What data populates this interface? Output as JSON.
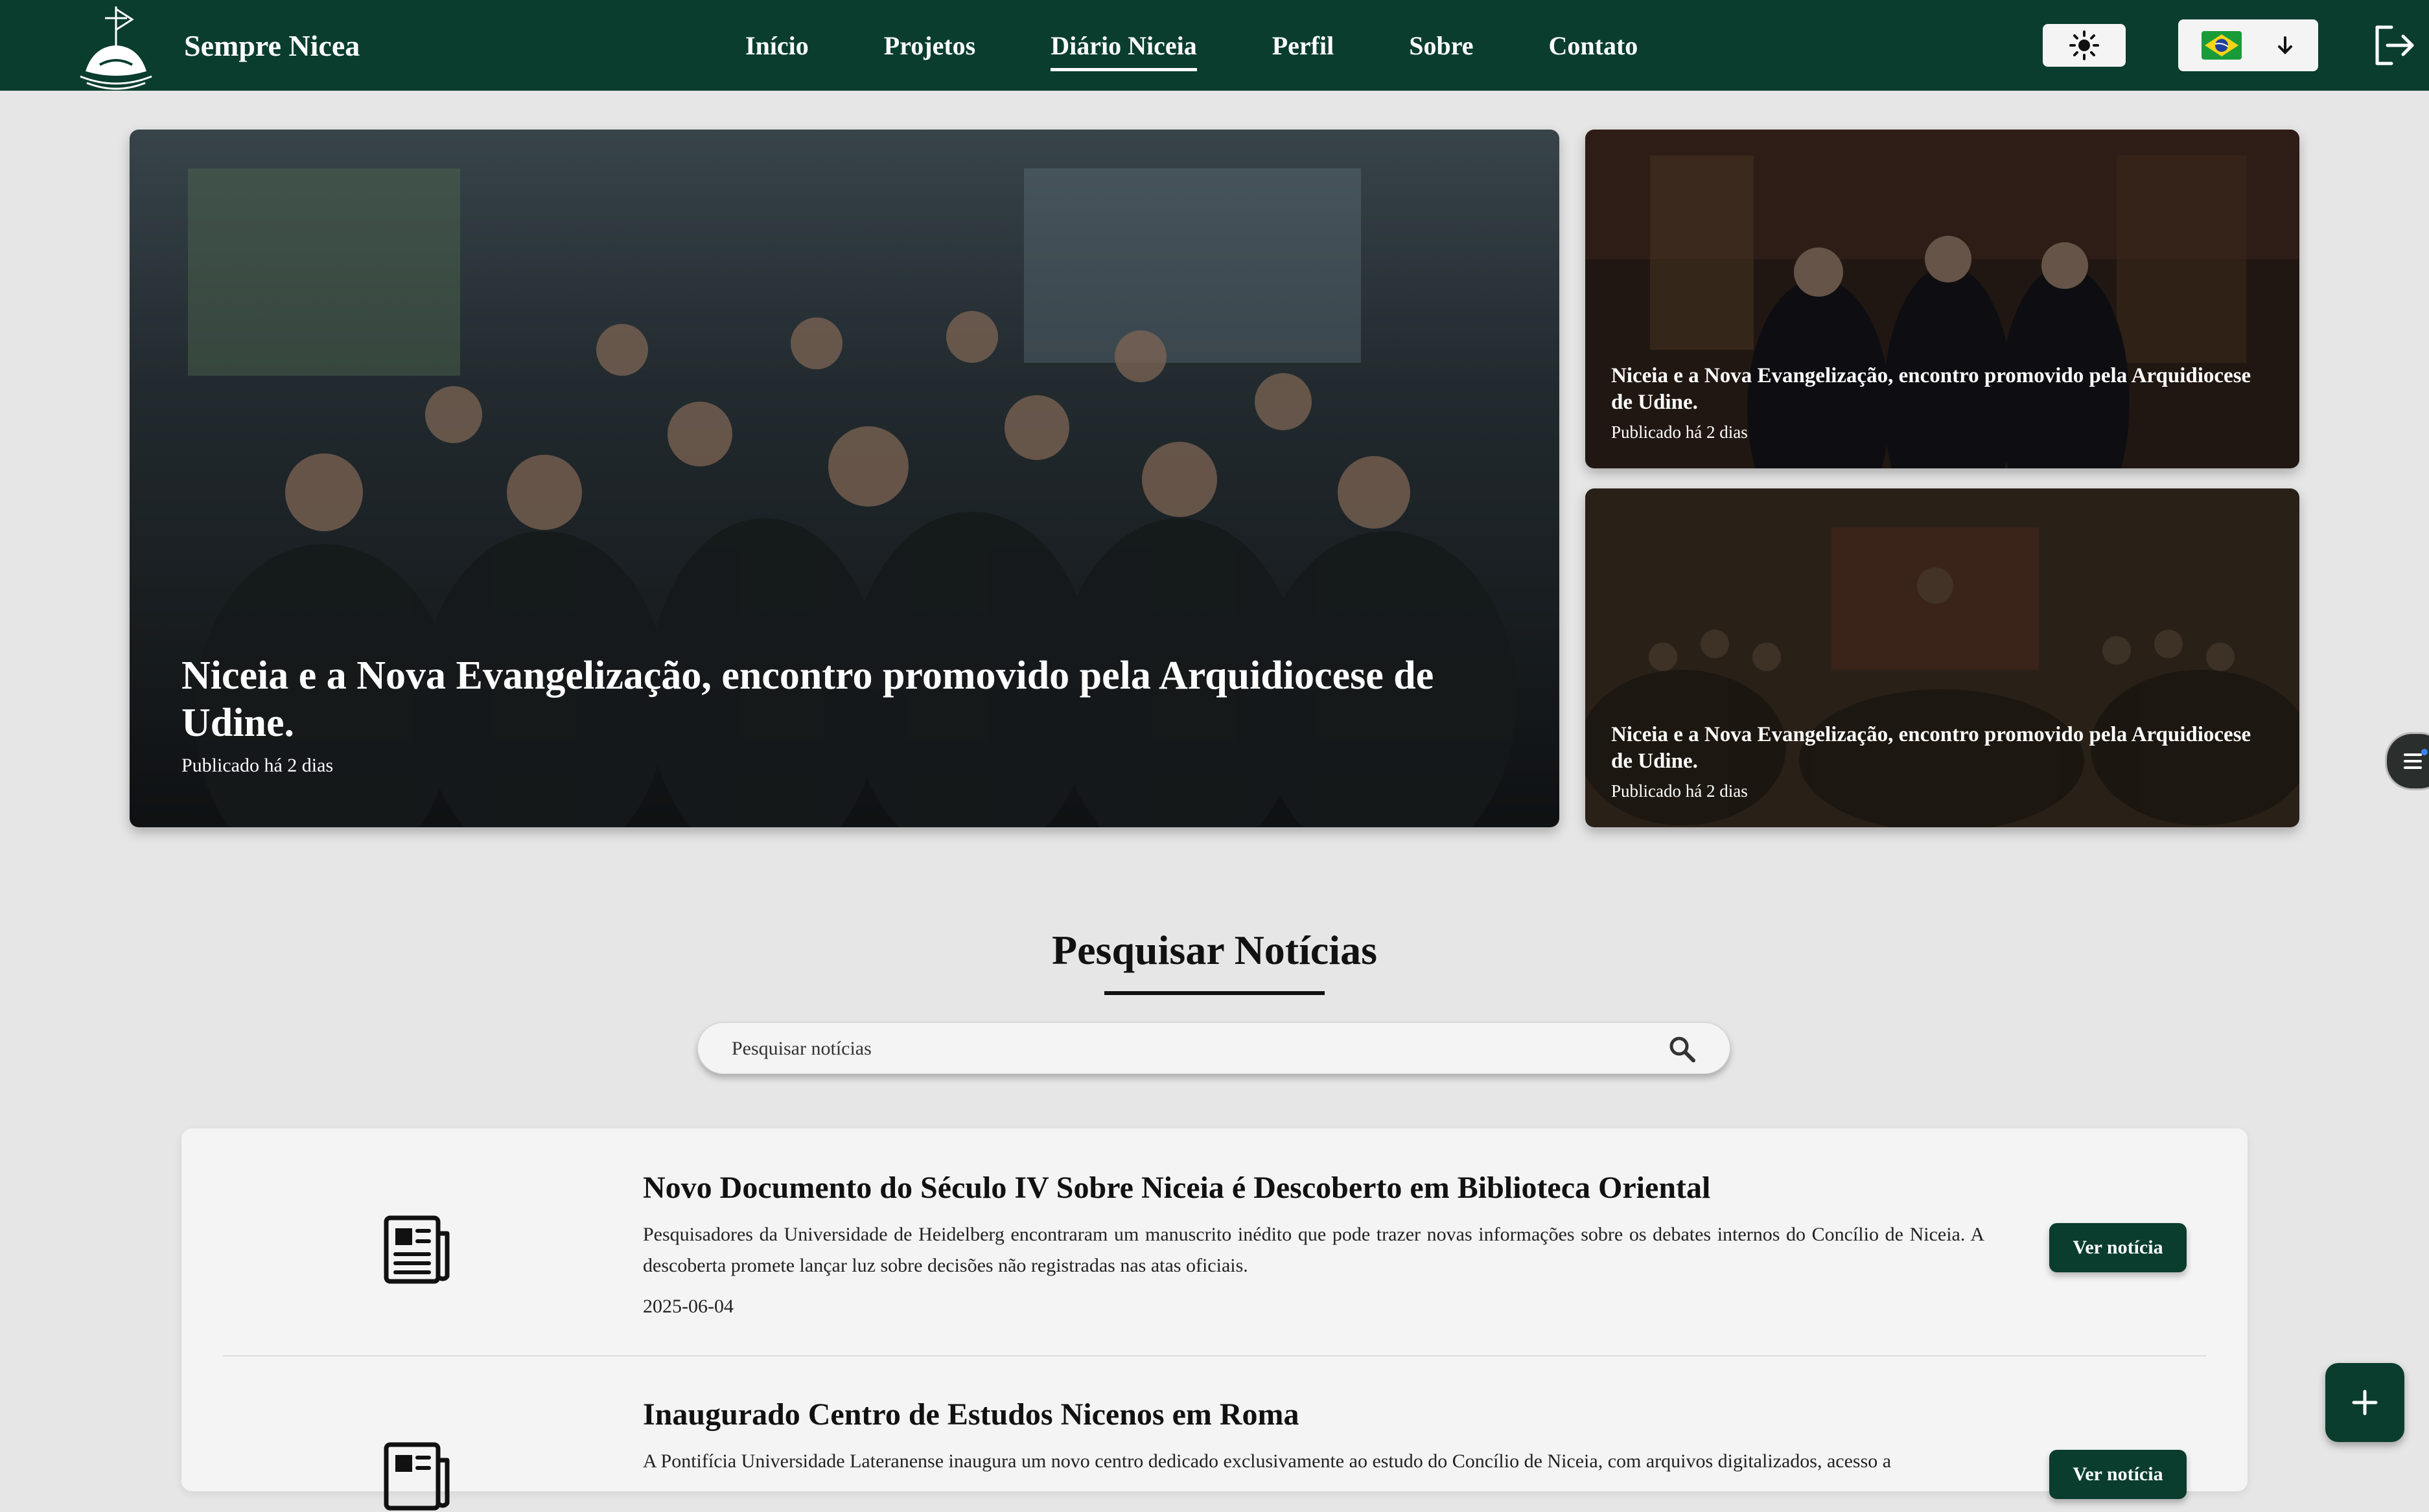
{
  "brand": {
    "name": "Sempre Nicea",
    "logo_icon": "ship-logo-icon"
  },
  "nav": {
    "items": [
      {
        "label": "Início"
      },
      {
        "label": "Projetos"
      },
      {
        "label": "Diário Niceia",
        "active": true
      },
      {
        "label": "Perfil"
      },
      {
        "label": "Sobre"
      },
      {
        "label": "Contato"
      }
    ],
    "theme_icon": "sun-icon",
    "language_flag": "brazil-flag-icon",
    "language_icon": "arrow-down-icon",
    "logout_icon": "logout-icon"
  },
  "featured": {
    "main": {
      "title": "Niceia e a Nova Evangelização, encontro promovido pela Arquidiocese de Udine.",
      "date": "Publicado há 2 dias"
    },
    "side": [
      {
        "title": "Niceia e a Nova Evangelização, encontro promovido pela Arquidiocese de Udine.",
        "date": "Publicado há 2 dias"
      },
      {
        "title": "Niceia e a Nova Evangelização, encontro promovido pela Arquidiocese de Udine.",
        "date": "Publicado há 2 dias"
      }
    ]
  },
  "search": {
    "title": "Pesquisar Notícias",
    "placeholder": "Pesquisar notícias",
    "icon": "search-icon"
  },
  "news": [
    {
      "title": "Novo Documento do Século IV Sobre Niceia é Descoberto em Biblioteca Oriental",
      "summary": "Pesquisadores da Universidade de Heidelberg encontraram um manuscrito inédito que pode trazer novas informações sobre os debates internos do Concílio de Niceia. A descoberta promete lançar luz sobre decisões não registradas nas atas oficiais.",
      "date": "2025-06-04",
      "button": "Ver notícia",
      "icon": "newspaper-icon"
    },
    {
      "title": "Inaugurado Centro de Estudos Nicenos em Roma",
      "summary": "A Pontifícia Universidade Lateranense inaugura um novo centro dedicado exclusivamente ao estudo do Concílio de Niceia, com arquivos digitalizados, acesso a",
      "date": "",
      "button": "Ver notícia",
      "icon": "newspaper-icon"
    }
  ],
  "colors": {
    "primary": "#0a3d2e",
    "background": "#e6e6e6",
    "panel": "#f4f4f4"
  },
  "fab_icon": "plus-icon"
}
